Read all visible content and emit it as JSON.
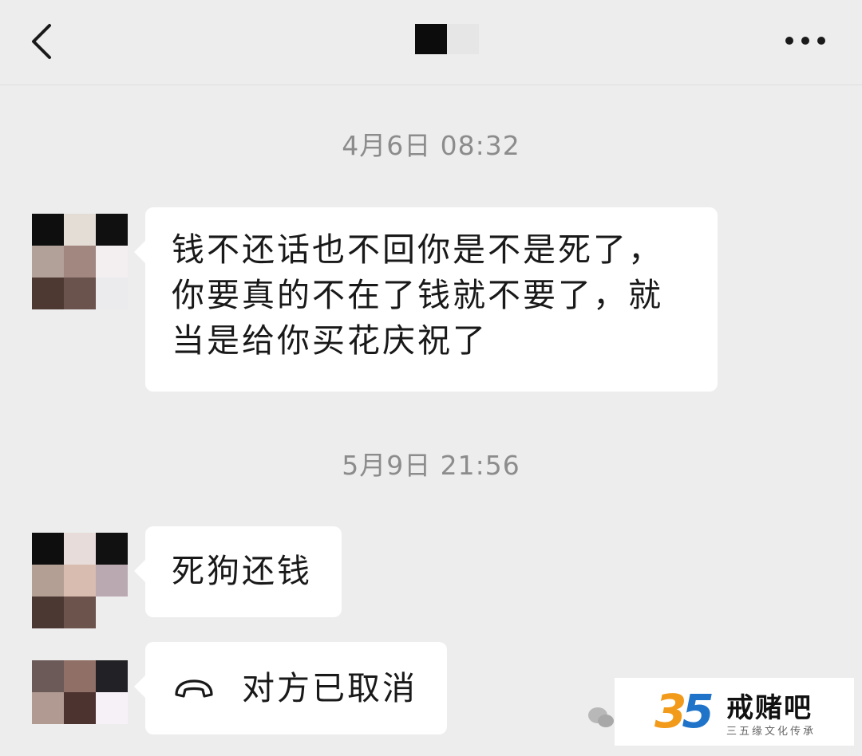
{
  "header": {
    "back_icon": "chevron-left-icon",
    "more_icon": "more-dots-icon"
  },
  "messages": [
    {
      "timestamp": "4月6日 08:32",
      "text_lines": [
        "钱不还话也不回你是不是死了，",
        "你要真的不在了钱就不要了，就",
        "当是给你买花庆祝了"
      ]
    },
    {
      "timestamp": "5月9日 21:56",
      "text": "死狗还钱"
    },
    {
      "call_icon": "phone-hangup-icon",
      "text": "对方已取消"
    }
  ],
  "watermark": {
    "number_a": "3",
    "number_b": "5",
    "title": "戒赌吧",
    "subtitle": "三五缘文化传承"
  },
  "colors": {
    "background": "#ededed",
    "bubble": "#ffffff",
    "timestamp": "#8c8c8c",
    "text": "#191919"
  }
}
